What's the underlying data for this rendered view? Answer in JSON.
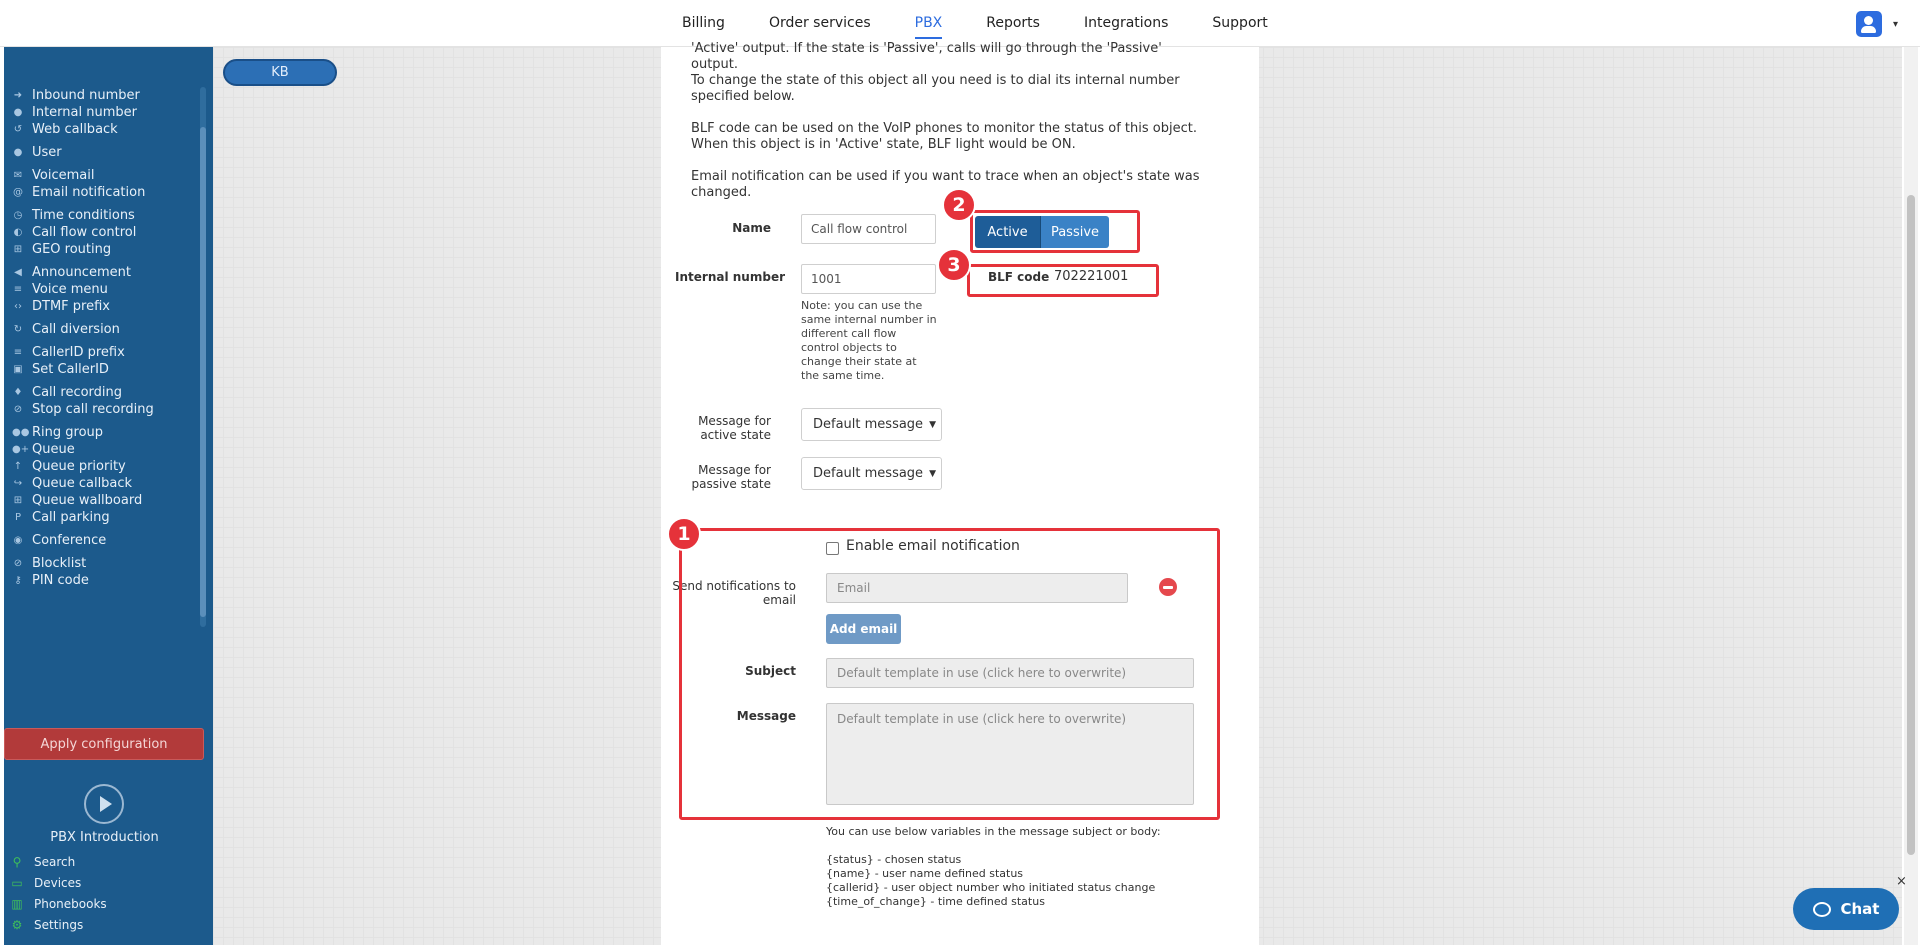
{
  "nav": {
    "items": [
      "Billing",
      "Order services",
      "PBX",
      "Reports",
      "Integrations",
      "Support"
    ],
    "active": "PBX"
  },
  "sidebar": {
    "items": [
      {
        "label": "Inbound number",
        "icon": "circle-arrow-icon"
      },
      {
        "label": "Internal number",
        "icon": "pin-icon"
      },
      {
        "label": "Web callback",
        "icon": "undo-icon"
      },
      {
        "label": "User",
        "icon": "user-icon"
      },
      {
        "label": "Voicemail",
        "icon": "envelope-icon"
      },
      {
        "label": "Email notification",
        "icon": "at-icon"
      },
      {
        "label": "Time conditions",
        "icon": "clock-icon"
      },
      {
        "label": "Call flow control",
        "icon": "toggle-icon"
      },
      {
        "label": "GEO routing",
        "icon": "sitemap-icon"
      },
      {
        "label": "Announcement",
        "icon": "megaphone-icon"
      },
      {
        "label": "Voice menu",
        "icon": "list-icon"
      },
      {
        "label": "DTMF prefix",
        "icon": "code-icon"
      },
      {
        "label": "Call diversion",
        "icon": "redo-icon"
      },
      {
        "label": "CallerID prefix",
        "icon": "bars-icon"
      },
      {
        "label": "Set CallerID",
        "icon": "id-card-icon"
      },
      {
        "label": "Call recording",
        "icon": "microphone-icon"
      },
      {
        "label": "Stop call recording",
        "icon": "microphone-slash-icon"
      },
      {
        "label": "Ring group",
        "icon": "users-icon"
      },
      {
        "label": "Queue",
        "icon": "user-plus-icon"
      },
      {
        "label": "Queue priority",
        "icon": "arrow-up-icon"
      },
      {
        "label": "Queue callback",
        "icon": "share-icon"
      },
      {
        "label": "Queue wallboard",
        "icon": "table-icon"
      },
      {
        "label": "Call parking",
        "icon": "parking-icon"
      },
      {
        "label": "Conference",
        "icon": "comments-icon"
      },
      {
        "label": "Blocklist",
        "icon": "ban-icon"
      },
      {
        "label": "PIN code",
        "icon": "key-icon"
      }
    ],
    "apply_label": "Apply configuration",
    "intro_label": "PBX Introduction",
    "bottom_items": [
      {
        "label": "Search",
        "icon": "search-icon"
      },
      {
        "label": "Devices",
        "icon": "monitor-icon"
      },
      {
        "label": "Phonebooks",
        "icon": "book-icon"
      },
      {
        "label": "Settings",
        "icon": "gear-icon"
      }
    ]
  },
  "workspace": {
    "kb_label": "KB"
  },
  "panel": {
    "intro_line": "'Active' output. If the state is 'Passive', calls will go through the 'Passive' output.",
    "para_change": [
      "To change the state of this object all you need is to dial its internal number",
      "specified below."
    ],
    "para_blf": [
      "BLF code can be used on the VoIP phones to monitor the status of this object.",
      "When this object is in 'Active' state, BLF light would be ON."
    ],
    "para_email": [
      "Email notification can be used if you want to trace when an object's state was",
      "changed."
    ],
    "name_label": "Name",
    "name_value": "Call flow control",
    "state_active": "Active",
    "state_passive": "Passive",
    "internal_label": "Internal number",
    "internal_value": "1001",
    "blf_label": "BLF code",
    "blf_value": "702221001",
    "note": "Note: you can use the same internal number in different call flow control objects to change their state at the same time.",
    "msg_active_label": "Message for active state",
    "msg_passive_label": "Message for passive state",
    "msg_active_value": "Default message",
    "msg_passive_value": "Default message",
    "enable_email_label": "Enable email notification",
    "send_label": "Send notifications to email",
    "email_placeholder": "Email",
    "add_email_label": "Add email",
    "subject_label": "Subject",
    "subject_placeholder": "Default template in use (click here to overwrite)",
    "message_label": "Message",
    "message_placeholder": "Default template in use (click here to overwrite)",
    "vars_intro": "You can use below variables in the message subject or body:",
    "vars": [
      "{status} - chosen status",
      "{name} - user name defined status",
      "{callerid} - user object number who initiated status change",
      "{time_of_change} - time defined status"
    ]
  },
  "annotations": [
    "1",
    "2",
    "3"
  ],
  "annotation_color": "#e5323a",
  "chat": {
    "label": "Chat",
    "close": "×"
  }
}
